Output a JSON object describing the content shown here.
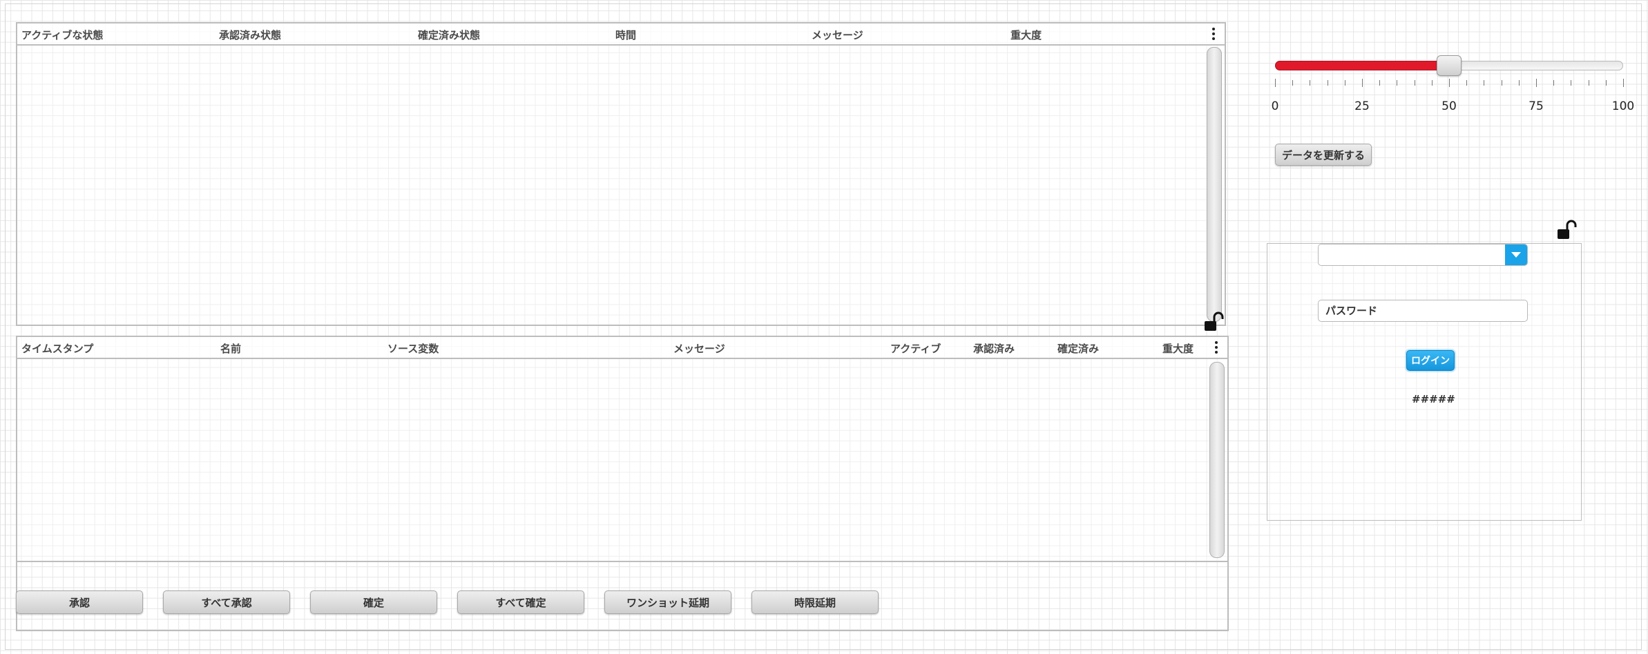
{
  "alarm_table": {
    "columns": [
      "アクティブな状態",
      "承認済み状態",
      "確定済み状態",
      "時間",
      "メッセージ",
      "重大度"
    ],
    "menu_icon": "kebab-menu-icon",
    "lock_icon": "unlocked-padlock-icon"
  },
  "history_table": {
    "columns": [
      "タイムスタンプ",
      "名前",
      "ソース変数",
      "メッセージ",
      "アクティブ",
      "承認済み",
      "確定済み",
      "重大度"
    ],
    "menu_icon": "kebab-menu-icon"
  },
  "actions": [
    {
      "label": "承認"
    },
    {
      "label": "すべて承認"
    },
    {
      "label": "確定"
    },
    {
      "label": "すべて確定"
    },
    {
      "label": "ワンショット延期"
    },
    {
      "label": "時限延期"
    }
  ],
  "slider": {
    "min": 0,
    "max": 100,
    "value": 50,
    "tick_labels": [
      "0",
      "25",
      "50",
      "75",
      "100"
    ],
    "fill_color": "#e01a2b"
  },
  "refresh_button": {
    "label": "データを更新する"
  },
  "login": {
    "user_select_value": "",
    "password_placeholder": "パスワード",
    "login_label": "ログイン",
    "status_text": "#####",
    "accent_color": "#1aa3e8",
    "lock_icon": "unlocked-padlock-icon"
  }
}
